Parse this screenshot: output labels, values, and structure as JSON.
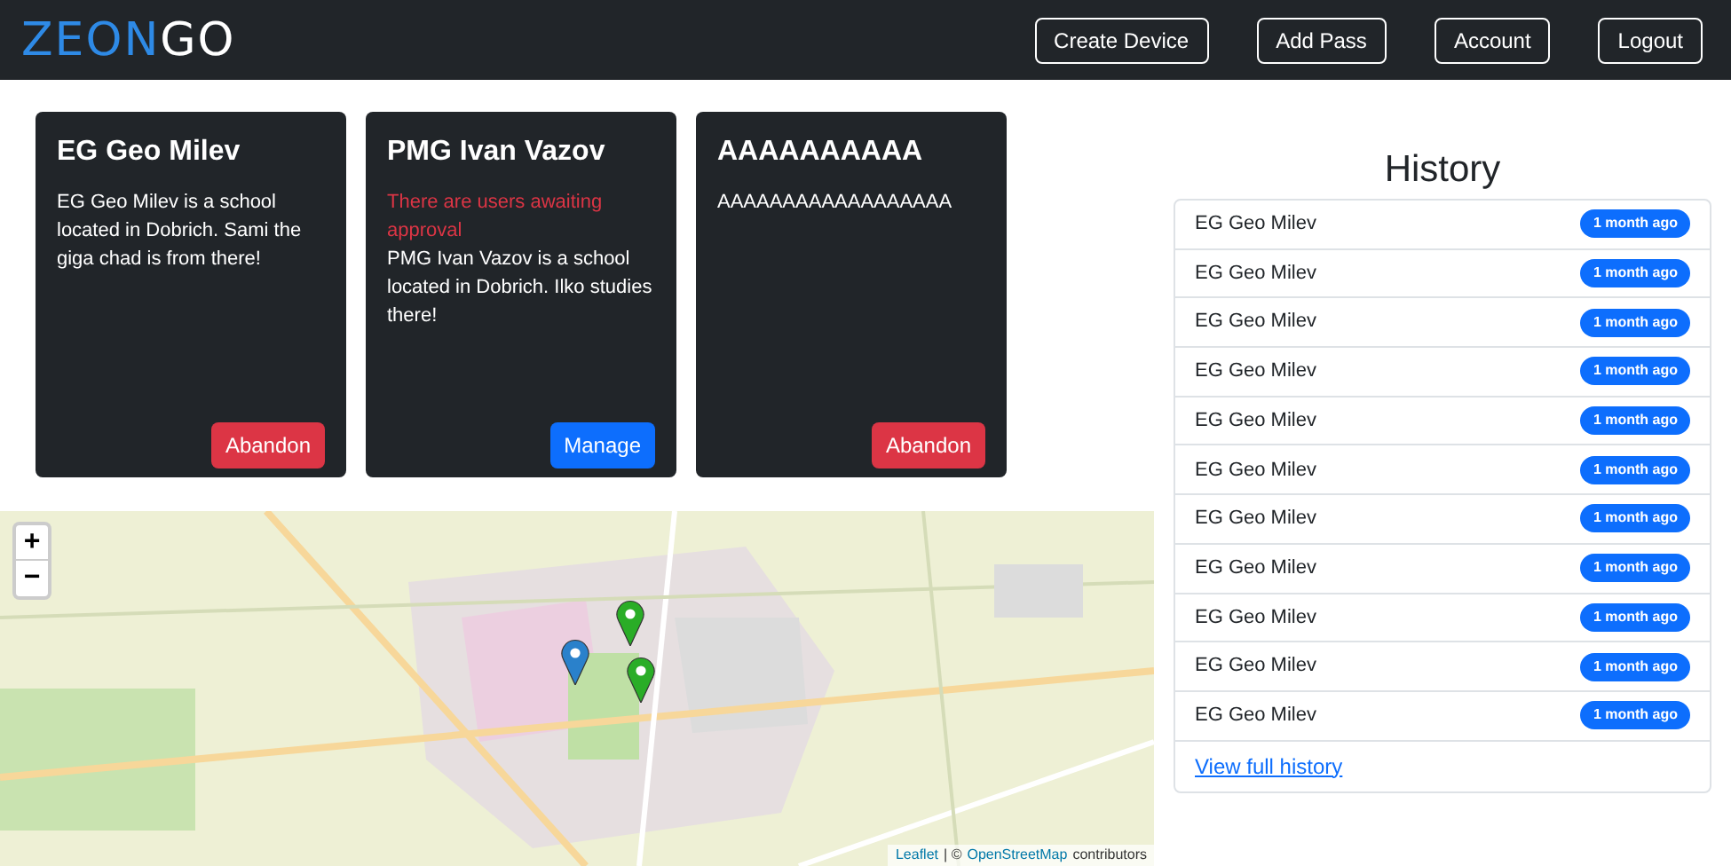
{
  "navbar": {
    "logo": {
      "part_1": "ZEON",
      "part_2": "GO"
    },
    "buttons": [
      "Create Device",
      "Add Pass",
      "Account",
      "Logout"
    ]
  },
  "cards": [
    {
      "title": "EG Geo Milev",
      "description": "EG Geo Milev is a school located in Dobrich. Sami the giga chad is from there!",
      "action": {
        "label": "Abandon",
        "kind": "danger"
      }
    },
    {
      "title": "PMG Ivan Vazov",
      "warning": "There are users awaiting approval",
      "description": "PMG Ivan Vazov is a school located in Dobrich. Ilko studies there!",
      "action": {
        "label": "Manage",
        "kind": "primary"
      }
    },
    {
      "title": "AAAAAAAAAA",
      "description": "AAAAAAAAAAAAAAAAAA",
      "action": {
        "label": "Abandon",
        "kind": "danger"
      }
    }
  ],
  "map": {
    "zoom_buttons": [
      "+",
      "−"
    ],
    "markers": [
      {
        "color": "#2a81cb"
      },
      {
        "color": "#2aad27"
      },
      {
        "color": "#2aad27"
      }
    ],
    "attribution": {
      "leaflet": "Leaflet",
      "separator": "| ©",
      "osm": "OpenStreetMap",
      "rest": "contributors"
    }
  },
  "history": {
    "title": "History",
    "items": [
      {
        "name": "EG Geo Milev",
        "time": "1 month ago"
      },
      {
        "name": "EG Geo Milev",
        "time": "1 month ago"
      },
      {
        "name": "EG Geo Milev",
        "time": "1 month ago"
      },
      {
        "name": "EG Geo Milev",
        "time": "1 month ago"
      },
      {
        "name": "EG Geo Milev",
        "time": "1 month ago"
      },
      {
        "name": "EG Geo Milev",
        "time": "1 month ago"
      },
      {
        "name": "EG Geo Milev",
        "time": "1 month ago"
      },
      {
        "name": "EG Geo Milev",
        "time": "1 month ago"
      },
      {
        "name": "EG Geo Milev",
        "time": "1 month ago"
      },
      {
        "name": "EG Geo Milev",
        "time": "1 month ago"
      },
      {
        "name": "EG Geo Milev",
        "time": "1 month ago"
      }
    ],
    "link": "View full history"
  }
}
